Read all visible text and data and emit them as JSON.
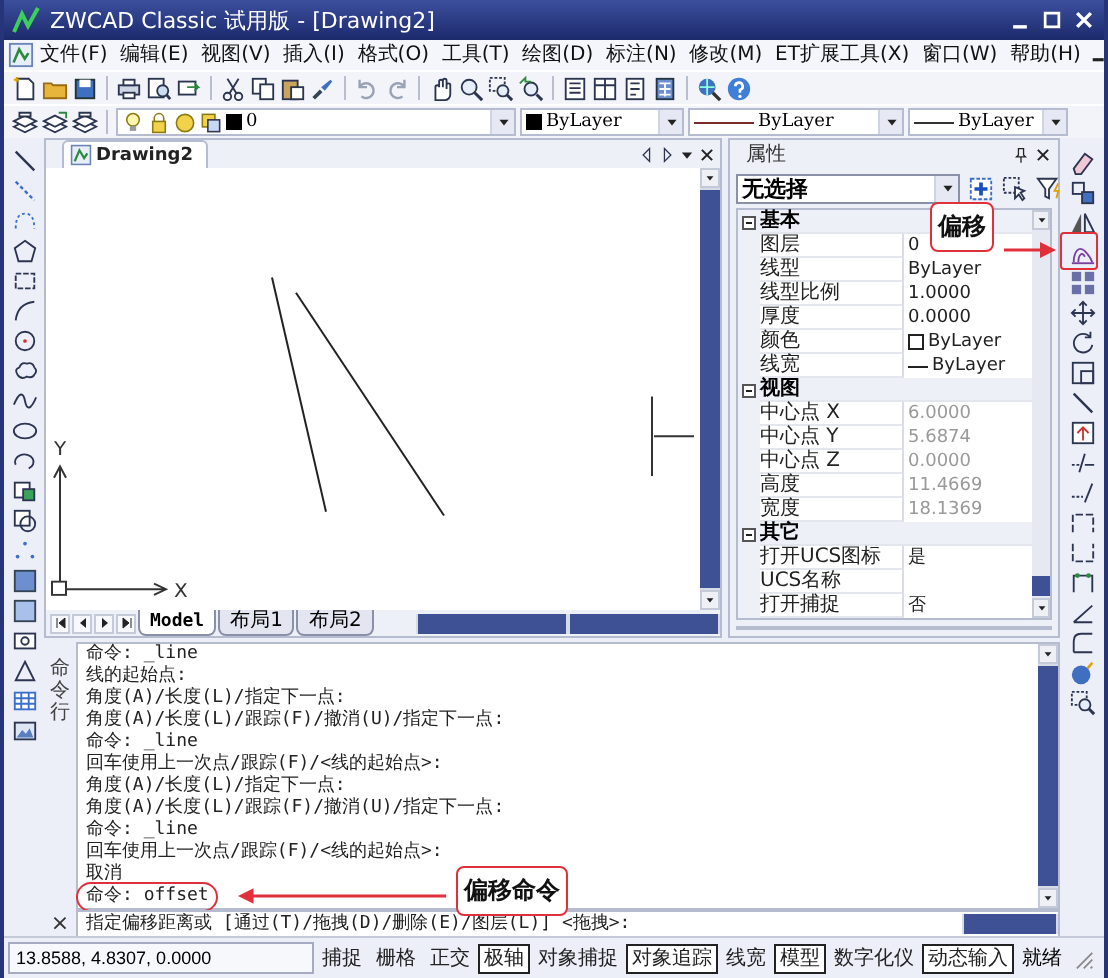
{
  "window": {
    "title": "ZWCAD Classic 试用版 - [Drawing2]"
  },
  "menu": [
    "文件(F)",
    "编辑(E)",
    "视图(V)",
    "插入(I)",
    "格式(O)",
    "工具(T)",
    "绘图(D)",
    "标注(N)",
    "修改(M)",
    "ET扩展工具(X)",
    "窗口(W)",
    "帮助(H)"
  ],
  "layer_toolbar": {
    "layer": "0",
    "color_dropdown": "ByLayer",
    "linetype": "ByLayer",
    "lineweight": "ByLayer"
  },
  "drawing": {
    "tab": "Drawing2",
    "axis_y": "Y",
    "axis_x": "X",
    "layout_tabs": [
      {
        "label": "Model",
        "selected": true
      },
      {
        "label": "布局1",
        "selected": false
      },
      {
        "label": "布局2",
        "selected": false
      }
    ]
  },
  "properties": {
    "title": "属性",
    "selection": "无选择",
    "sections": [
      {
        "label": "基本",
        "expanded": true,
        "rows": [
          {
            "name": "图层",
            "value": "0",
            "kind": "text",
            "readonly": false
          },
          {
            "name": "线型",
            "value": "ByLayer",
            "kind": "text",
            "readonly": false
          },
          {
            "name": "线型比例",
            "value": "1.0000",
            "kind": "text",
            "readonly": false
          },
          {
            "name": "厚度",
            "value": "0.0000",
            "kind": "text",
            "readonly": false
          },
          {
            "name": "颜色",
            "value": "ByLayer",
            "kind": "color",
            "readonly": false
          },
          {
            "name": "线宽",
            "value": "ByLayer",
            "kind": "lineweight",
            "readonly": false
          }
        ]
      },
      {
        "label": "视图",
        "expanded": true,
        "rows": [
          {
            "name": "中心点 X",
            "value": "6.0000",
            "kind": "text",
            "readonly": true
          },
          {
            "name": "中心点 Y",
            "value": "5.6874",
            "kind": "text",
            "readonly": true
          },
          {
            "name": "中心点 Z",
            "value": "0.0000",
            "kind": "text",
            "readonly": true
          },
          {
            "name": "高度",
            "value": "11.4669",
            "kind": "text",
            "readonly": true
          },
          {
            "name": "宽度",
            "value": "18.1369",
            "kind": "text",
            "readonly": true
          }
        ]
      },
      {
        "label": "其它",
        "expanded": true,
        "rows": [
          {
            "name": "打开UCS图标",
            "value": "是",
            "kind": "text",
            "readonly": false
          },
          {
            "name": "UCS名称",
            "kind": "text"
          },
          {
            "name": "打开捕捉",
            "value": "否",
            "kind": "text",
            "readonly": false
          }
        ]
      }
    ]
  },
  "command": {
    "label": "命令行",
    "close": "×",
    "history": [
      "命令: _line",
      "线的起始点:",
      "角度(A)/长度(L)/指定下一点:",
      "角度(A)/长度(L)/跟踪(F)/撤消(U)/指定下一点:",
      "命令: _line",
      "回车使用上一次点/跟踪(F)/<线的起始点>:",
      "角度(A)/长度(L)/指定下一点:",
      "角度(A)/长度(L)/跟踪(F)/撤消(U)/指定下一点:",
      "命令: _line",
      "回车使用上一次点/跟踪(F)/<线的起始点>:",
      "取消",
      "命令: offset"
    ],
    "prompt": "指定偏移距离或 [通过(T)/拖拽(D)/删除(E)/图层(L)] <拖拽>:"
  },
  "status_bar": {
    "coordinates": "13.8588,  4.8307,  0.0000",
    "toggles": [
      {
        "label": "捕捉",
        "on": false
      },
      {
        "label": "栅格",
        "on": false
      },
      {
        "label": "正交",
        "on": false
      },
      {
        "label": "极轴",
        "on": true
      },
      {
        "label": "对象捕捉",
        "on": false
      },
      {
        "label": "对象追踪",
        "on": true
      },
      {
        "label": "线宽",
        "on": false
      },
      {
        "label": "模型",
        "on": true
      },
      {
        "label": "数字化仪",
        "on": false
      },
      {
        "label": "动态输入",
        "on": true
      }
    ],
    "state": "就绪"
  },
  "annotations": [
    {
      "kind": "toolbar",
      "text": "偏移"
    },
    {
      "kind": "command",
      "text": "偏移命令"
    }
  ]
}
